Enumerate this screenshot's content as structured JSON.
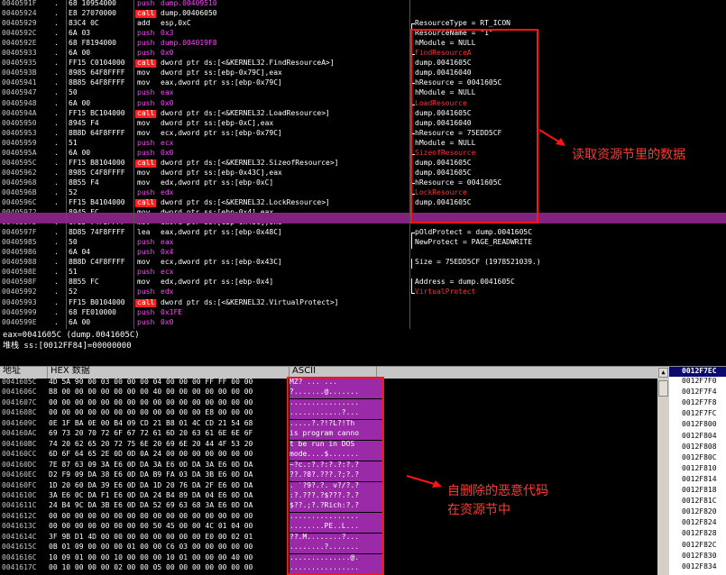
{
  "disasm": {
    "rows": [
      {
        "addr": "0040591F",
        "mark": ".",
        "hex": "68 10954000",
        "mnem": "push",
        "mnem_type": "push",
        "operand": "dump.00409510"
      },
      {
        "addr": "00405924",
        "mark": ".",
        "hex": "E8 27070000",
        "mnem": "call",
        "mnem_type": "call",
        "operand": "dump.00406050"
      },
      {
        "addr": "00405929",
        "mark": ".",
        "hex": "83C4 0C",
        "mnem": "add",
        "mnem_type": "plain",
        "operand": "esp,0xC"
      },
      {
        "addr": "0040592C",
        "mark": ".",
        "hex": "6A 03",
        "mnem": "push",
        "mnem_type": "push",
        "operand": "0x3"
      },
      {
        "addr": "0040592E",
        "mark": ".",
        "hex": "68 F8194000",
        "mnem": "push",
        "mnem_type": "push",
        "operand": "dump.004019F8"
      },
      {
        "addr": "00405933",
        "mark": ".",
        "hex": "6A 00",
        "mnem": "push",
        "mnem_type": "push",
        "operand": "0x0"
      },
      {
        "addr": "00405935",
        "mark": ".",
        "hex": "FF15 C0104000",
        "mnem": "call",
        "mnem_type": "call",
        "operand": "dword ptr ds:[<&KERNEL32.FindResourceA>]"
      },
      {
        "addr": "0040593B",
        "mark": ".",
        "hex": "8985 64F8FFFF",
        "mnem": "mov",
        "mnem_type": "mov",
        "operand": "dword ptr ss:[ebp-0x79C],eax"
      },
      {
        "addr": "00405941",
        "mark": ".",
        "hex": "8B85 64F8FFFF",
        "mnem": "mov",
        "mnem_type": "mov",
        "operand": "eax,dword ptr ss:[ebp-0x79C]"
      },
      {
        "addr": "00405947",
        "mark": ".",
        "hex": "50",
        "mnem": "push",
        "mnem_type": "push",
        "operand": "eax"
      },
      {
        "addr": "00405948",
        "mark": ".",
        "hex": "6A 00",
        "mnem": "push",
        "mnem_type": "push",
        "operand": "0x0"
      },
      {
        "addr": "0040594A",
        "mark": ".",
        "hex": "FF15 BC104000",
        "mnem": "call",
        "mnem_type": "call",
        "operand": "dword ptr ds:[<&KERNEL32.LoadResource>]"
      },
      {
        "addr": "00405950",
        "mark": ".",
        "hex": "8945 F4",
        "mnem": "mov",
        "mnem_type": "mov",
        "operand": "dword ptr ss:[ebp-0xC],eax"
      },
      {
        "addr": "00405953",
        "mark": ".",
        "hex": "8B8D 64F8FFFF",
        "mnem": "mov",
        "mnem_type": "mov",
        "operand": "ecx,dword ptr ss:[ebp-0x79C]"
      },
      {
        "addr": "00405959",
        "mark": ".",
        "hex": "51",
        "mnem": "push",
        "mnem_type": "push",
        "operand": "ecx"
      },
      {
        "addr": "0040595A",
        "mark": ".",
        "hex": "6A 00",
        "mnem": "push",
        "mnem_type": "push",
        "operand": "0x0"
      },
      {
        "addr": "0040595C",
        "mark": ".",
        "hex": "FF15 B8104000",
        "mnem": "call",
        "mnem_type": "call",
        "operand": "dword ptr ds:[<&KERNEL32.SizeofResource>]"
      },
      {
        "addr": "00405962",
        "mark": ".",
        "hex": "8985 C4F8FFFF",
        "mnem": "mov",
        "mnem_type": "mov",
        "operand": "dword ptr ss:[ebp-0x43C],eax"
      },
      {
        "addr": "00405968",
        "mark": ".",
        "hex": "8B55 F4",
        "mnem": "mov",
        "mnem_type": "mov",
        "operand": "edx,dword ptr ss:[ebp-0xC]"
      },
      {
        "addr": "0040596B",
        "mark": ".",
        "hex": "52",
        "mnem": "push",
        "mnem_type": "push",
        "operand": "edx"
      },
      {
        "addr": "0040596C",
        "mark": ".",
        "hex": "FF15 B4104000",
        "mnem": "call",
        "mnem_type": "call",
        "operand": "dword ptr ds:[<&KERNEL32.LockResource>]"
      },
      {
        "addr": "00405972",
        "mark": ".",
        "hex": "8945 FC",
        "mnem": "mov",
        "mnem_type": "mov",
        "operand": "dword ptr ss:[ebp-0x4],eax"
      },
      {
        "addr": "00405975",
        "mark": ".",
        "hex": "C785 74F8FFFF",
        "mnem": "mov",
        "mnem_type": "mov",
        "operand": "dword ptr ss:[ebp-0x48C],0x0"
      },
      {
        "addr": "0040597F",
        "mark": ".",
        "hex": "8D85 74F8FFFF",
        "mnem": "lea",
        "mnem_type": "plain",
        "operand": "eax,dword ptr ss:[ebp-0x48C]"
      },
      {
        "addr": "00405985",
        "mark": ".",
        "hex": "50",
        "mnem": "push",
        "mnem_type": "push",
        "operand": "eax"
      },
      {
        "addr": "00405986",
        "mark": ".",
        "hex": "6A 04",
        "mnem": "push",
        "mnem_type": "push",
        "operand": "0x4"
      },
      {
        "addr": "00405988",
        "mark": ".",
        "hex": "8B8D C4F8FFFF",
        "mnem": "mov",
        "mnem_type": "mov",
        "operand": "ecx,dword ptr ss:[ebp-0x43C]"
      },
      {
        "addr": "0040598E",
        "mark": ".",
        "hex": "51",
        "mnem": "push",
        "mnem_type": "push",
        "operand": "ecx"
      },
      {
        "addr": "0040598F",
        "mark": ".",
        "hex": "8B55 FC",
        "mnem": "mov",
        "mnem_type": "mov",
        "operand": "edx,dword ptr ss:[ebp-0x4]"
      },
      {
        "addr": "00405992",
        "mark": ".",
        "hex": "52",
        "mnem": "push",
        "mnem_type": "push",
        "operand": "edx"
      },
      {
        "addr": "00405993",
        "mark": ".",
        "hex": "FF15 B0104000",
        "mnem": "call",
        "mnem_type": "call",
        "operand": "dword ptr ds:[<&KERNEL32.VirtualProtect>]"
      },
      {
        "addr": "00405999",
        "mark": ".",
        "hex": "68 FE010000",
        "mnem": "push",
        "mnem_type": "push",
        "operand": "0x1FE"
      },
      {
        "addr": "0040599E",
        "mark": ".",
        "hex": "6A 00",
        "mnem": "push",
        "mnem_type": "push",
        "operand": "0x0"
      }
    ],
    "selected_index": 21,
    "comments": [
      {
        "row": 2,
        "text": "ResourceType = RT_ICON",
        "kind": "arg",
        "bracket": "top"
      },
      {
        "row": 3,
        "text": "ResourceName = \"1\"",
        "kind": "arg",
        "bracket": "mid"
      },
      {
        "row": 4,
        "text": "hModule = NULL",
        "kind": "arg",
        "bracket": "mid"
      },
      {
        "row": 5,
        "text": "FindResourceA",
        "kind": "api",
        "bracket": "end"
      },
      {
        "row": 6,
        "text": "dump.0041605C",
        "kind": "val",
        "bracket": ""
      },
      {
        "row": 7,
        "text": "dump.00416040",
        "kind": "val",
        "bracket": ""
      },
      {
        "row": 8,
        "text": "hResource = 0041605C",
        "kind": "arg",
        "bracket": "top"
      },
      {
        "row": 9,
        "text": "hModule = NULL",
        "kind": "arg",
        "bracket": "mid"
      },
      {
        "row": 10,
        "text": "LoadResource",
        "kind": "api",
        "bracket": "end"
      },
      {
        "row": 11,
        "text": "dump.0041605C",
        "kind": "val",
        "bracket": ""
      },
      {
        "row": 12,
        "text": "dump.00416040",
        "kind": "val",
        "bracket": ""
      },
      {
        "row": 13,
        "text": "hResource = 75EDD5CF",
        "kind": "arg",
        "bracket": "top"
      },
      {
        "row": 14,
        "text": "hModule = NULL",
        "kind": "arg",
        "bracket": "mid"
      },
      {
        "row": 15,
        "text": "SizeofResource",
        "kind": "api",
        "bracket": "end"
      },
      {
        "row": 16,
        "text": "dump.0041605C",
        "kind": "val",
        "bracket": ""
      },
      {
        "row": 17,
        "text": "dump.0041605C",
        "kind": "val",
        "bracket": ""
      },
      {
        "row": 18,
        "text": "hResource = 0041605C",
        "kind": "arg",
        "bracket": "top"
      },
      {
        "row": 19,
        "text": "LockResource",
        "kind": "api",
        "bracket": "end"
      },
      {
        "row": 20,
        "text": "dump.0041605C",
        "kind": "val",
        "bracket": ""
      },
      {
        "row": 23,
        "text": "pOldProtect = dump.0041605C",
        "kind": "arg",
        "bracket": "top"
      },
      {
        "row": 24,
        "text": "NewProtect = PAGE_READWRITE",
        "kind": "arg",
        "bracket": "mid"
      },
      {
        "row": 26,
        "text": "Size = 75EDD5CF (1978521039.)",
        "kind": "arg",
        "bracket": "mid"
      },
      {
        "row": 28,
        "text": "Address = dump.0041605C",
        "kind": "arg",
        "bracket": "mid"
      },
      {
        "row": 29,
        "text": "VirtualProtect",
        "kind": "api",
        "bracket": "end"
      }
    ]
  },
  "info": {
    "line1": "eax=0041605C (dump.0041605C)",
    "line2": "堆栈 ss:[0012FF84]=00000000"
  },
  "dump": {
    "header_addr": "地址",
    "header_hex": "HEX 数据",
    "header_ascii": "ASCII",
    "rows": [
      {
        "addr": "0041605C",
        "hex": "4D 5A 90 00 03 00 00 00 04 00 00 00 FF FF 00 00",
        "ascii": "MZ? ...   ..."
      },
      {
        "addr": "0041606C",
        "hex": "B8 00 00 00 00 00 00 00 40 00 00 00 00 00 00 00",
        "ascii": "?.......@......."
      },
      {
        "addr": "0041607C",
        "hex": "00 00 00 00 00 00 00 00 00 00 00 00 00 00 00 00",
        "ascii": "................"
      },
      {
        "addr": "0041608C",
        "hex": "00 00 00 00 00 00 00 00 00 00 00 00 E8 00 00 00",
        "ascii": "............?..."
      },
      {
        "addr": "0041609C",
        "hex": "0E 1F BA 0E 00 B4 09 CD 21 B8 01 4C CD 21 54 68",
        "ascii": ".....?.?!?L?!Th"
      },
      {
        "addr": "004160AC",
        "hex": "69 73 20 70 72 6F 67 72 61 6D 20 63 61 6E 6E 6F",
        "ascii": "is program canno"
      },
      {
        "addr": "004160BC",
        "hex": "74 20 62 65 20 72 75 6E 20 69 6E 20 44 4F 53 20",
        "ascii": "t be run in DOS "
      },
      {
        "addr": "004160CC",
        "hex": "6D 6F 64 65 2E 0D 0D 0A 24 00 00 00 00 00 00 00",
        "ascii": "mode....$......."
      },
      {
        "addr": "004160DC",
        "hex": "7E 87 63 09 3A E6 0D DA 3A E6 0D DA 3A E6 0D DA",
        "ascii": "~?c.:?.?:?.?:?.?"
      },
      {
        "addr": "004160EC",
        "hex": "D2 F9 09 DA 38 E6 0D DA B9 FA 03 DA 3B E6 0D DA",
        "ascii": "??.?8?.???.?;?.?"
      },
      {
        "addr": "004160FC",
        "hex": "1D 20 60 DA 39 E6 0D DA 1D 20 76 DA 2F E6 0D DA",
        "ascii": ". `?9?.?. v?/?.?"
      },
      {
        "addr": "0041610C",
        "hex": "3A E6 0C DA F1 E6 0D DA 24 B4 89 DA 04 E6 0D DA",
        "ascii": ":?.???.?$???.?.?"
      },
      {
        "addr": "0041611C",
        "hex": "24 B4 9C DA 3B E6 0D DA 52 69 63 68 3A E6 0D DA",
        "ascii": "$??.;?.?Rich:?.?"
      },
      {
        "addr": "0041612C",
        "hex": "00 00 00 00 00 00 00 00 00 00 00 00 00 00 00 00",
        "ascii": "................"
      },
      {
        "addr": "0041613C",
        "hex": "00 00 00 00 00 00 00 00 50 45 00 00 4C 01 04 00",
        "ascii": "........PE..L..."
      },
      {
        "addr": "0041614C",
        "hex": "3F 9B D1 4D 00 00 00 00 00 00 00 00 E0 00 02 01",
        "ascii": "??.M........?..."
      },
      {
        "addr": "0041615C",
        "hex": "0B 01 09 00 00 00 01 00 00 C6 03 00 00 00 00 00",
        "ascii": "........?......."
      },
      {
        "addr": "0041616C",
        "hex": "10 09 01 00 00 10 00 00 00 10 01 00 00 00 40 00",
        "ascii": "..............@."
      },
      {
        "addr": "0041617C",
        "hex": "00 10 00 00 00 02 00 00 05 00 00 00 00 00 00 00",
        "ascii": "................"
      }
    ]
  },
  "stack": {
    "header": "0012F7EC",
    "rows": [
      "0012F7F0",
      "0012F7F4",
      "0012F7F8",
      "0012F7FC",
      "0012F800",
      "0012F804",
      "0012F808",
      "0012F80C",
      "0012F810",
      "0012F814",
      "0012F818",
      "0012F81C",
      "0012F820",
      "0012F824",
      "0012F828",
      "0012F82C",
      "0012F830",
      "0012F834"
    ]
  },
  "annotations": {
    "top": "读取资源节里的数据",
    "bottom_line1": "自删除的恶意代码",
    "bottom_line2": "在资源节中"
  },
  "colors": {
    "call_bg": "#ff2020",
    "push_text": "#ff40ff",
    "mov_text": "#ffffff",
    "api_text": "#ff3030",
    "highlight_row": "#84227f",
    "ascii_bg": "#9a2aa8",
    "annotation": "#ff3a2f"
  }
}
